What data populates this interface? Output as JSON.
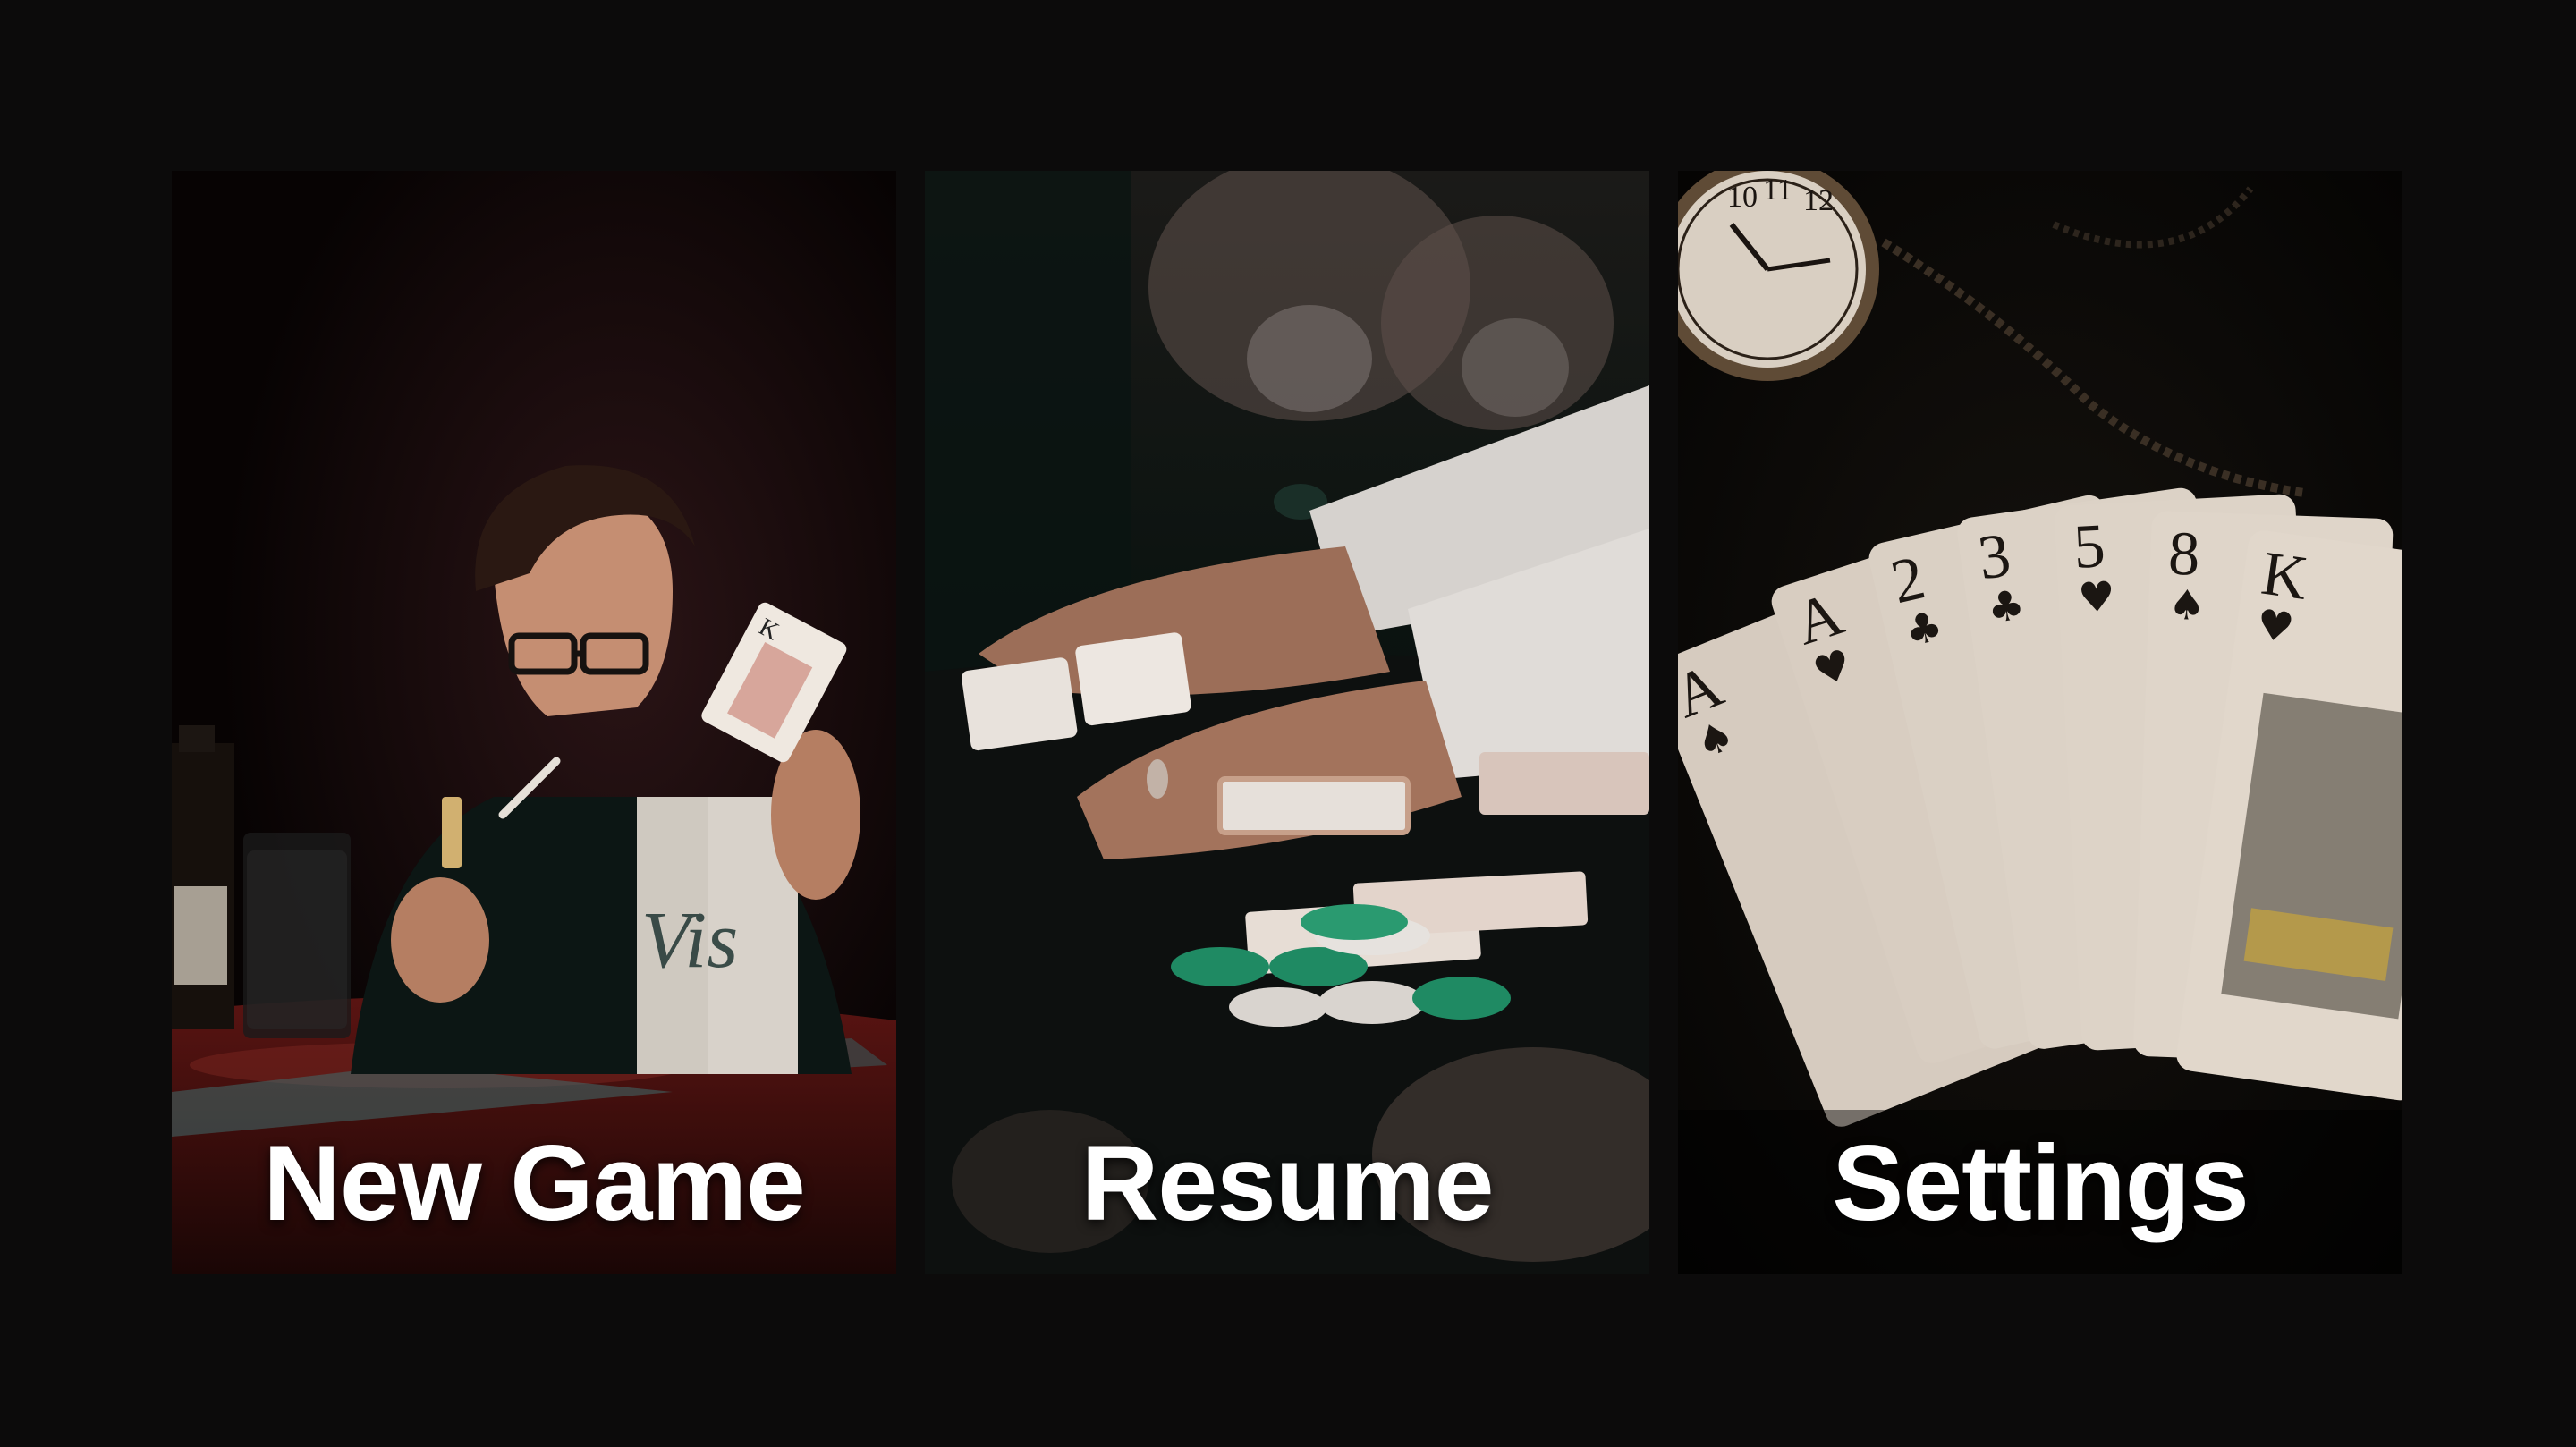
{
  "menu": {
    "items": [
      {
        "label": "New Game"
      },
      {
        "label": "Resume"
      },
      {
        "label": "Settings"
      }
    ]
  },
  "colors": {
    "background": "#0c0b0b",
    "label": "#ffffff",
    "chip_green": "#1f8a63",
    "card_face": "#d9cfc4",
    "card_back": "#c7a08a"
  },
  "icons": [
    "card-player-photo",
    "dealer-hands-photo",
    "card-fan-photo"
  ]
}
